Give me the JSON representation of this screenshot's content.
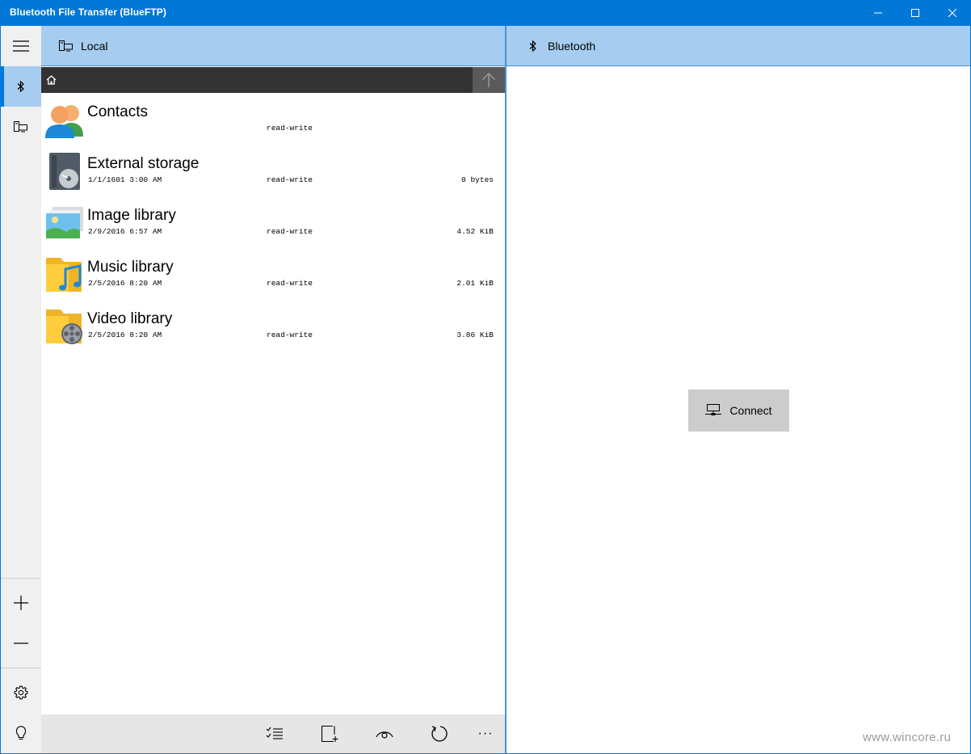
{
  "window": {
    "title": "Bluetooth File Transfer (BlueFTP)",
    "accent": "#0078d7"
  },
  "rail": {
    "items": [
      {
        "icon": "hamburger-menu-icon"
      },
      {
        "icon": "bluetooth-icon",
        "active": true
      },
      {
        "icon": "local-computer-icon"
      },
      {
        "icon": "plus-icon"
      },
      {
        "icon": "minus-icon"
      },
      {
        "icon": "gear-icon"
      },
      {
        "icon": "lightbulb-icon"
      }
    ]
  },
  "left_pane": {
    "header_label": "Local",
    "header_icon": "local-computer-icon",
    "path_icon": "home-icon",
    "up_icon": "arrow-up-icon",
    "files": [
      {
        "name": "Contacts",
        "date": "",
        "permission": "read-write",
        "size": "",
        "icon": "contacts-icon"
      },
      {
        "name": "External storage",
        "date": "1/1/1601 3:00 AM",
        "permission": "read-write",
        "size": "0 bytes",
        "icon": "external-storage-icon"
      },
      {
        "name": "Image library",
        "date": "2/9/2016 6:57 AM",
        "permission": "read-write",
        "size": "4.52 KiB",
        "icon": "image-library-icon"
      },
      {
        "name": "Music library",
        "date": "2/5/2016 8:20 AM",
        "permission": "read-write",
        "size": "2.01 KiB",
        "icon": "music-library-icon"
      },
      {
        "name": "Video library",
        "date": "2/5/2016 8:20 AM",
        "permission": "read-write",
        "size": "3.86 KiB",
        "icon": "video-library-icon"
      }
    ],
    "toolbar": [
      {
        "icon": "select-list-icon"
      },
      {
        "icon": "new-folder-icon"
      },
      {
        "icon": "view-eye-icon"
      },
      {
        "icon": "refresh-icon"
      },
      {
        "icon": "more-ellipsis-icon",
        "label": "···"
      }
    ]
  },
  "right_pane": {
    "header_label": "Bluetooth",
    "header_icon": "bluetooth-icon",
    "connect_label": "Connect",
    "connect_icon": "connect-network-icon"
  },
  "watermark": "www.wincore.ru"
}
